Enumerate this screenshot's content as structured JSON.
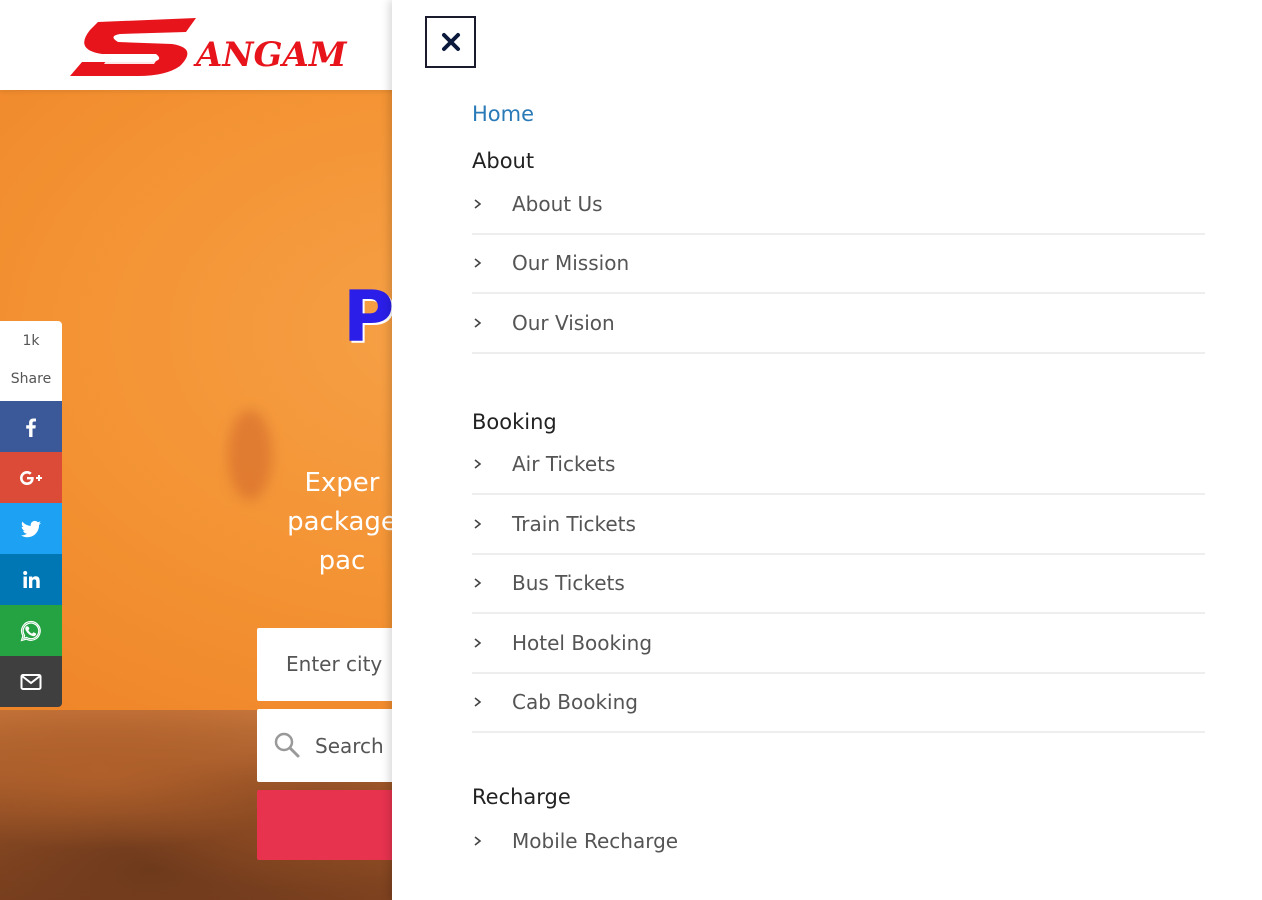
{
  "brand": {
    "logo_text": "ANGAM",
    "logo_letter": "S",
    "color": "#e8141c"
  },
  "hero": {
    "title": "P",
    "subtitle_lines": [
      "Exper",
      "package",
      "pac"
    ],
    "city_placeholder": "Enter city",
    "search_text": "Search",
    "title_color": "#2a1ee8",
    "button_color": "#e8334f"
  },
  "share": {
    "count": "1k",
    "label": "Share",
    "buttons": [
      {
        "name": "facebook-icon",
        "color": "#3b5998"
      },
      {
        "name": "google-plus-icon",
        "color": "#dc4a38"
      },
      {
        "name": "twitter-icon",
        "color": "#1da1f2"
      },
      {
        "name": "linkedin-icon",
        "color": "#0077b5"
      },
      {
        "name": "whatsapp-icon",
        "color": "#25a343"
      },
      {
        "name": "email-icon",
        "color": "#3f3f3f"
      }
    ]
  },
  "drawer": {
    "close_icon": "close-icon",
    "home": "Home",
    "home_color": "#2a7ab8",
    "sections": [
      {
        "title": "About",
        "items": [
          "About Us",
          "Our Mission",
          "Our Vision"
        ]
      },
      {
        "title": "Booking",
        "items": [
          "Air Tickets",
          "Train Tickets",
          "Bus Tickets",
          "Hotel Booking",
          "Cab Booking"
        ]
      },
      {
        "title": "Recharge",
        "items": [
          "Mobile Recharge"
        ]
      }
    ]
  }
}
